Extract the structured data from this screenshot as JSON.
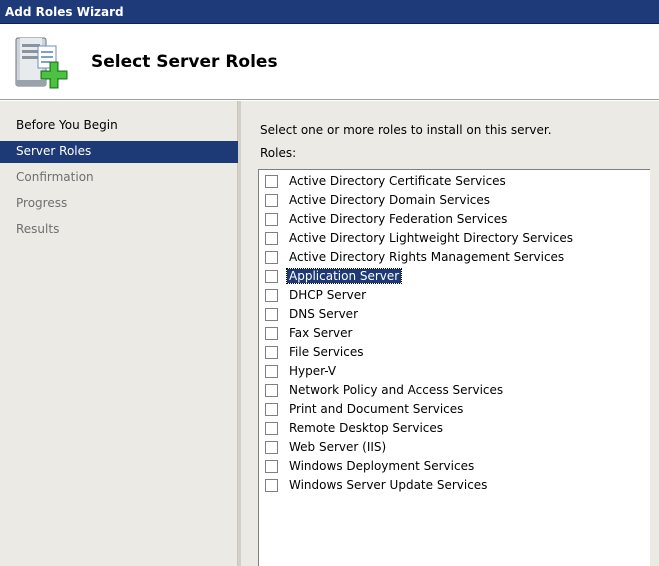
{
  "window": {
    "title": "Add Roles Wizard"
  },
  "header": {
    "title": "Select Server Roles",
    "icon": "server-add-icon"
  },
  "nav": {
    "items": [
      {
        "label": "Before You Begin",
        "state": "normal"
      },
      {
        "label": "Server Roles",
        "state": "selected"
      },
      {
        "label": "Confirmation",
        "state": "disabled"
      },
      {
        "label": "Progress",
        "state": "disabled"
      },
      {
        "label": "Results",
        "state": "disabled"
      }
    ]
  },
  "main": {
    "instruction": "Select one or more roles to install on this server.",
    "roles_label": "Roles:",
    "roles": [
      {
        "label": "Active Directory Certificate Services",
        "checked": false
      },
      {
        "label": "Active Directory Domain Services",
        "checked": false
      },
      {
        "label": "Active Directory Federation Services",
        "checked": false
      },
      {
        "label": "Active Directory Lightweight Directory Services",
        "checked": false
      },
      {
        "label": "Active Directory Rights Management Services",
        "checked": false
      },
      {
        "label": "Application Server",
        "checked": false,
        "selected": true
      },
      {
        "label": "DHCP Server",
        "checked": false
      },
      {
        "label": "DNS Server",
        "checked": false
      },
      {
        "label": "Fax Server",
        "checked": false
      },
      {
        "label": "File Services",
        "checked": false
      },
      {
        "label": "Hyper-V",
        "checked": false
      },
      {
        "label": "Network Policy and Access Services",
        "checked": false
      },
      {
        "label": "Print and Document Services",
        "checked": false
      },
      {
        "label": "Remote Desktop Services",
        "checked": false
      },
      {
        "label": "Web Server (IIS)",
        "checked": false
      },
      {
        "label": "Windows Deployment Services",
        "checked": false
      },
      {
        "label": "Windows Server Update Services",
        "checked": false
      }
    ]
  },
  "colors": {
    "title_bar": "#1f3a78",
    "selection": "#1e3a76",
    "panel": "#ebeae5"
  }
}
